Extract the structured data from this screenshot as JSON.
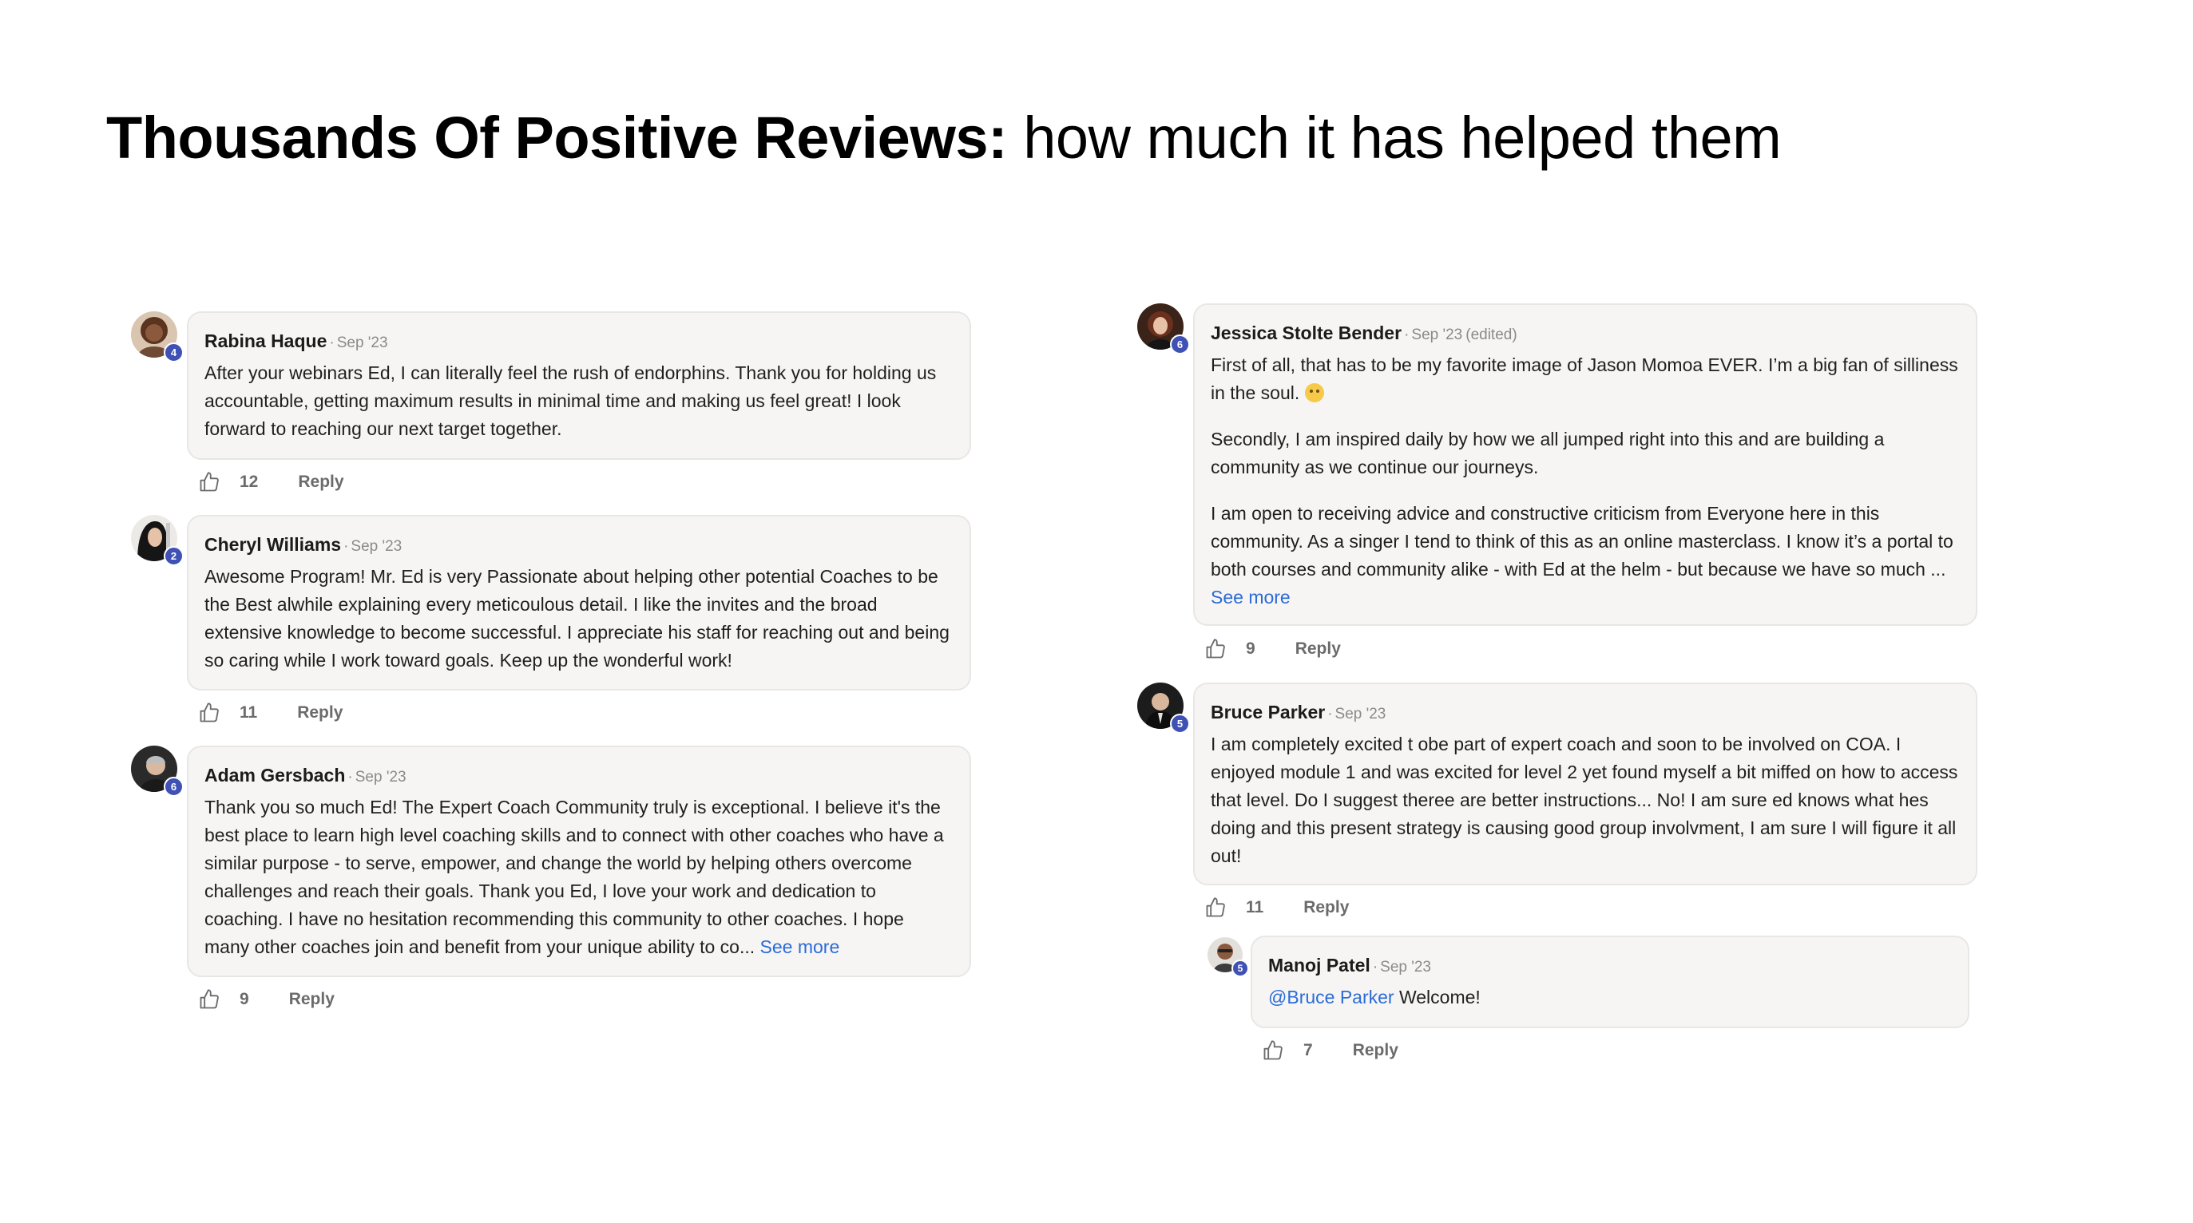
{
  "headline": {
    "bold": "Thousands Of Positive Reviews:",
    "regular": "how much it has helped them"
  },
  "comments": [
    {
      "author": "Rabina Haque",
      "date": "Sep '23",
      "level": "4",
      "paragraphs": [
        "After your webinars Ed, I can literally feel the rush of endorphins. Thank you for holding us accountable, getting maximum results in minimal time and making us feel great! I look forward to reaching our next target together."
      ],
      "likes": "12",
      "reply_label": "Reply"
    },
    {
      "author": "Cheryl Williams",
      "date": "Sep '23",
      "level": "2",
      "paragraphs": [
        "Awesome Program! Mr. Ed is very Passionate about helping other potential Coaches to be the Best alwhile explaining every meticoulous detail. I like the invites and the broad extensive knowledge to become successful. I appreciate his staff for reaching out and being so caring while I work toward goals. Keep up the wonderful work!"
      ],
      "likes": "11",
      "reply_label": "Reply"
    },
    {
      "author": "Adam Gersbach",
      "date": "Sep '23",
      "level": "6",
      "paragraphs": [
        "Thank you so much Ed! The Expert Coach Community truly is exceptional. I believe it's the best place to learn high level coaching skills and to connect with other coaches who have a similar purpose - to serve, empower, and change the world by helping others overcome challenges and reach their goals. Thank you Ed, I love your work and dedication to coaching. I have no hesitation recommending this community to other coaches. I hope many other coaches join and benefit from your unique ability to co..."
      ],
      "see_more": "See more",
      "likes": "9",
      "reply_label": "Reply"
    },
    {
      "author": "Jessica Stolte Bender",
      "date": "Sep '23",
      "edited": "(edited)",
      "level": "6",
      "paragraphs": [
        "First of all, that has to be my favorite image of Jason Momoa EVER. I’m a big fan of silliness in the soul.",
        "Secondly, I am inspired daily by how we all jumped right into this and are building a community as we continue our journeys.",
        "I am open to receiving advice and constructive criticism from Everyone here in this community. As a singer I tend to think of this as an online masterclass. I know it’s a portal to both courses and community alike - with Ed at the helm - but because we have so much ..."
      ],
      "emoji": "relieved-face-emoji",
      "see_more": "See more",
      "likes": "9",
      "reply_label": "Reply"
    },
    {
      "author": "Bruce Parker",
      "date": "Sep '23",
      "level": "5",
      "paragraphs": [
        "I am completely excited t obe part of expert coach and soon to be involved on COA. I enjoyed module 1 and was excited for level 2 yet found myself a bit miffed on how to access that level. Do I suggest theree are better instructions... No! I am sure ed knows what hes doing and this present strategy is causing good group involvment, I am sure I will figure it all out!"
      ],
      "likes": "11",
      "reply_label": "Reply"
    },
    {
      "author": "Manoj Patel",
      "date": "Sep '23",
      "level": "5",
      "mention": "@Bruce Parker",
      "paragraphs": [
        "Welcome!"
      ],
      "likes": "7",
      "reply_label": "Reply"
    }
  ],
  "colors": {
    "badge": "#3f51b5",
    "link": "#2b6bd8",
    "bubble": "#f6f5f3"
  }
}
